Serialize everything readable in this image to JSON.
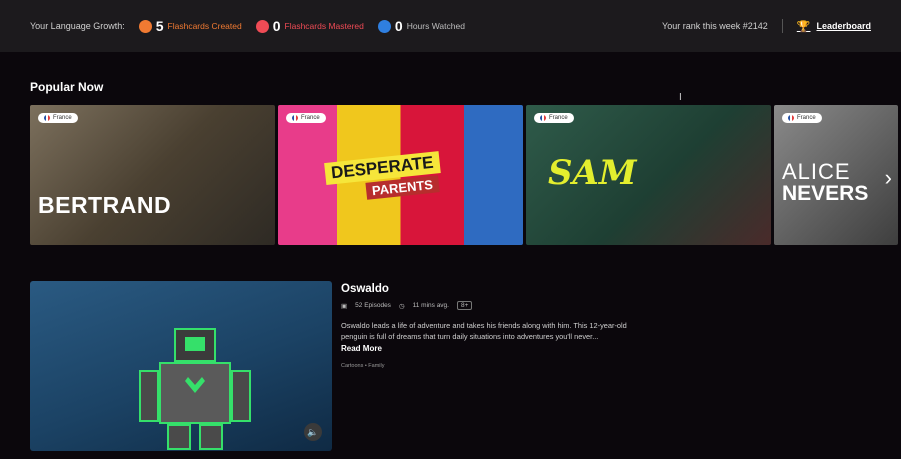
{
  "topbar": {
    "growth_label": "Your Language Growth:",
    "stats": [
      {
        "icon": "flashcard-icon",
        "value": "5",
        "label": "Flashcards Created",
        "color": "#f07a32"
      },
      {
        "icon": "mastered-icon",
        "value": "0",
        "label": "Flashcards Mastered",
        "color": "#ef4b55"
      },
      {
        "icon": "clock-icon",
        "value": "0",
        "label": "Hours Watched",
        "color": "#bdbdbd"
      }
    ],
    "rank_text": "Your rank this week #2142",
    "leaderboard_label": "Leaderboard"
  },
  "popular": {
    "title": "Popular Now",
    "cards": [
      {
        "badge": "France",
        "title": "BERTRAND"
      },
      {
        "badge": "France",
        "title_line1": "DESPERATE",
        "title_line2": "PARENTS"
      },
      {
        "badge": "France",
        "title": "SAM"
      },
      {
        "badge": "France",
        "title_line1": "ALICE",
        "title_line2": "NEVERS"
      }
    ]
  },
  "feature": {
    "title": "Oswaldo",
    "episodes": "52 Episodes",
    "duration": "11 mins avg.",
    "rating": "8+",
    "description": "Oswaldo leads a life of adventure and takes his friends along with him. This 12-year-old penguin is full of dreams that turn daily situations into adventures you'll never...",
    "read_more": "Read More",
    "genres": "Cartoons • Family"
  }
}
